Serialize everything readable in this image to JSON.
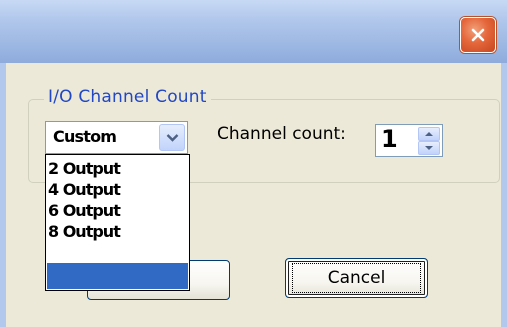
{
  "dialog": {
    "group_title": "I/O Channel Count",
    "combo_value": "Custom",
    "channel_label": "Channel count:",
    "channel_value": "1",
    "dropdown_items": [
      "2 Output",
      "4 Output",
      "6 Output",
      "8 Output"
    ],
    "cancel_label": "Cancel",
    "ok_label": ""
  },
  "icons": {
    "close": "close-icon",
    "combo_arrow": "chevron-down-icon",
    "spin_up": "spin-up-icon",
    "spin_down": "spin-down-icon"
  },
  "colors": {
    "selection": "#316ac5",
    "group_title": "#2147c4",
    "close_button": "#e4663a"
  }
}
